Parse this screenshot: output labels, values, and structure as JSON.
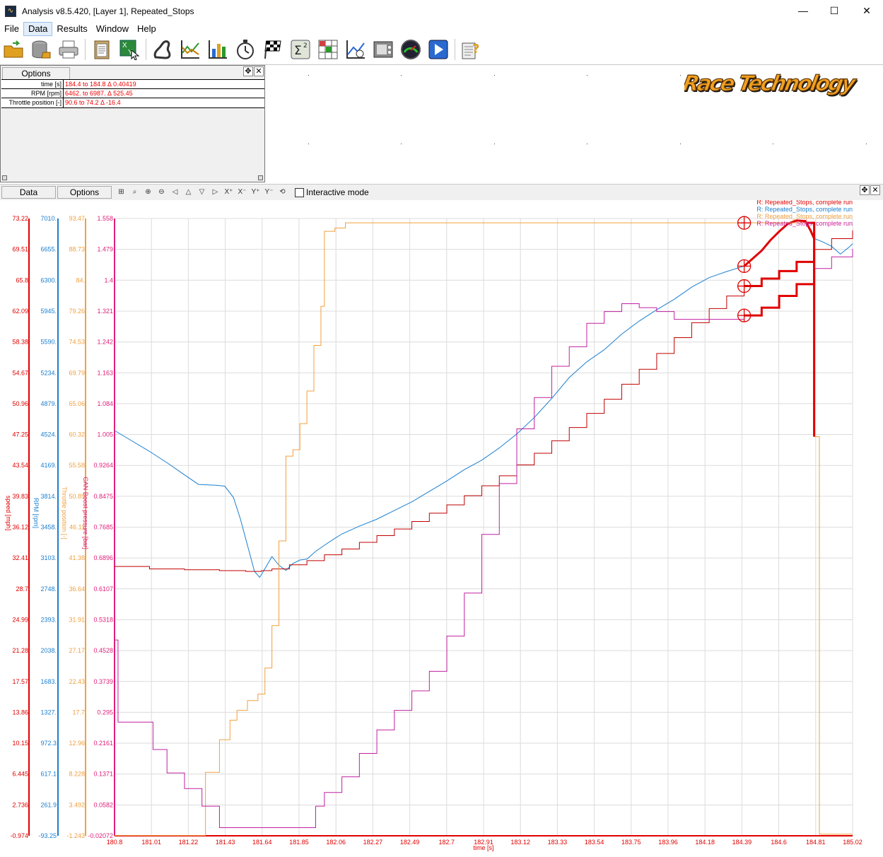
{
  "window": {
    "title": "Analysis v8.5.420, [Layer 1], Repeated_Stops",
    "min_glyph": "—",
    "max_glyph": "☐",
    "close_glyph": "✕"
  },
  "menu": [
    "File",
    "Data",
    "Results",
    "Window",
    "Help"
  ],
  "toolbar_icons": [
    "open-folder-icon",
    "database-icon",
    "printer-icon",
    "clipboard-icon",
    "xy-export-icon",
    "track-map-icon",
    "line-graph-icon",
    "bar-chart-icon",
    "stopwatch-icon",
    "checkered-flag-icon",
    "sigma-squared-icon",
    "lap-table-icon",
    "xy-scatter-icon",
    "video-icon",
    "gauge-icon",
    "play-icon",
    "help-icon"
  ],
  "upper_panel": {
    "options_label": "Options",
    "rows": [
      {
        "name": "time [s]",
        "value": "184.4 to 184.8 Δ 0.40419"
      },
      {
        "name": "RPM [rpm]",
        "value": "6462. to 6987. Δ 525.45"
      },
      {
        "name": "Throttle position [-]",
        "value": "90.6 to 74.2 Δ -16.4"
      }
    ],
    "logo_text": "Race Technology"
  },
  "graph_panel": {
    "tabs": [
      "Data",
      "Options"
    ],
    "interactive_label": "Interactive mode"
  },
  "chart_data": {
    "type": "line",
    "xlabel": "time [s]",
    "x_ticks": [
      "180.8",
      "181.01",
      "181.22",
      "181.43",
      "181.64",
      "181.85",
      "182.06",
      "182.27",
      "182.49",
      "182.7",
      "182.91",
      "183.12",
      "183.33",
      "183.54",
      "183.75",
      "183.96",
      "184.18",
      "184.39",
      "184.6",
      "184.81",
      "185.02"
    ],
    "xlim": [
      180.8,
      185.02
    ],
    "cursor_range": [
      184.4,
      184.8
    ],
    "grid": true,
    "legend": [
      {
        "text": "R:  Repeated_Stops, complete run",
        "color": "#e00000"
      },
      {
        "text": "R:  Repeated_Stops, complete run",
        "color": "#1a7fd0"
      },
      {
        "text": "R:  Repeated_Stops, complete run",
        "color": "#f0a040"
      },
      {
        "text": "R:  Repeated_Stops, complete run",
        "color": "#d0209a"
      }
    ],
    "axes": [
      {
        "label": "speed [mph]",
        "color": "#e00000",
        "ylim": [
          -0.974,
          73.22
        ],
        "ticks": [
          "73.22",
          "69.51",
          "65.8",
          "62.09",
          "58.38",
          "54.67",
          "50.96",
          "47.25",
          "43.54",
          "39.83",
          "36.12",
          "32.41",
          "28.7",
          "24.99",
          "21.28",
          "17.57",
          "13.86",
          "10.15",
          "6.445",
          "2.736",
          "-0.974"
        ]
      },
      {
        "label": "RPM [rpm]",
        "color": "#1a7fd0",
        "ylim": [
          -93.25,
          7010
        ],
        "ticks": [
          "7010.",
          "6655.",
          "6300.",
          "5945.",
          "5590.",
          "5234.",
          "4879.",
          "4524.",
          "4169.",
          "3814.",
          "3458.",
          "3103.",
          "2748.",
          "2393.",
          "2038.",
          "1683.",
          "1327.",
          "972.3",
          "617.1",
          "261.9",
          "-93.25"
        ]
      },
      {
        "label": "Throttle position [-]",
        "color": "#f0a040",
        "ylim": [
          -1.243,
          93.47
        ],
        "ticks": [
          "93.47",
          "88.73",
          "84.",
          "79.26",
          "74.53",
          "69.79",
          "65.06",
          "60.32",
          "55.58",
          "50.85",
          "46.11",
          "41.38",
          "36.64",
          "31.91",
          "27.17",
          "22.43",
          "17.7",
          "12.96",
          "8.228",
          "3.492",
          "-1.243"
        ]
      },
      {
        "label": "CAN Boost pressure [bar]",
        "color": "#e0207a",
        "ylim": [
          -0.02072,
          1.558
        ],
        "ticks": [
          "1.558",
          "1.479",
          "1.4",
          "1.321",
          "1.242",
          "1.163",
          "1.084",
          "1.005",
          "0.9264",
          "0.8475",
          "0.7685",
          "0.6896",
          "0.6107",
          "0.5318",
          "0.4528",
          "0.3739",
          "0.295",
          "0.2161",
          "0.1371",
          "0.0582",
          "-0.02072"
        ]
      }
    ],
    "series": [
      {
        "name": "RPM [rpm]",
        "axis": 1,
        "color": "#1a7fd0",
        "x": [
          180.8,
          180.9,
          181.0,
          181.1,
          181.2,
          181.28,
          181.38,
          181.43,
          181.48,
          181.52,
          181.56,
          181.6,
          181.63,
          181.66,
          181.7,
          181.74,
          181.78,
          181.82,
          181.86,
          181.9,
          181.95,
          182.0,
          182.06,
          182.1,
          182.2,
          182.3,
          182.4,
          182.5,
          182.6,
          182.7,
          182.8,
          182.9,
          183.0,
          183.1,
          183.2,
          183.3,
          183.4,
          183.5,
          183.6,
          183.7,
          183.8,
          183.9,
          184.0,
          184.1,
          184.2,
          184.3,
          184.4,
          184.5,
          184.55,
          184.6,
          184.65,
          184.7,
          184.75,
          184.78,
          184.8,
          184.85,
          184.9,
          184.95,
          185.0,
          185.02
        ],
        "y": [
          4570,
          4450,
          4330,
          4200,
          4060,
          3950,
          3940,
          3930,
          3800,
          3550,
          3250,
          2950,
          2880,
          2980,
          3120,
          3020,
          2960,
          3040,
          3080,
          3090,
          3180,
          3250,
          3330,
          3380,
          3470,
          3550,
          3650,
          3750,
          3870,
          3990,
          4120,
          4230,
          4370,
          4530,
          4720,
          4940,
          5180,
          5360,
          5500,
          5680,
          5830,
          5960,
          6080,
          6220,
          6330,
          6400,
          6462,
          6640,
          6760,
          6860,
          6950,
          6987,
          6980,
          6870,
          6780,
          6740,
          6690,
          6600,
          6680,
          6720
        ]
      },
      {
        "name": "speed [mph]",
        "axis": 0,
        "color": "#c00000",
        "x": [
          180.8,
          181.0,
          181.2,
          181.4,
          181.55,
          181.64,
          181.7,
          181.8,
          181.9,
          182.0,
          182.1,
          182.2,
          182.3,
          182.4,
          182.5,
          182.6,
          182.7,
          182.8,
          182.9,
          183.0,
          183.1,
          183.2,
          183.3,
          183.4,
          183.5,
          183.6,
          183.7,
          183.8,
          183.9,
          184.0,
          184.1,
          184.2,
          184.3,
          184.4,
          184.5,
          184.6,
          184.7,
          184.8,
          184.9,
          185.02
        ],
        "y": [
          31.4,
          31.1,
          31.0,
          30.9,
          30.8,
          30.9,
          31.1,
          31.6,
          32.1,
          32.8,
          33.5,
          34.3,
          35.1,
          35.9,
          36.8,
          37.8,
          38.8,
          39.9,
          41.1,
          42.3,
          43.6,
          45.0,
          46.5,
          48.1,
          49.8,
          51.5,
          53.3,
          55.1,
          57.0,
          58.9,
          60.7,
          62.4,
          63.9,
          65.1,
          66.0,
          66.9,
          68.0,
          69.5,
          70.8,
          71.8
        ]
      },
      {
        "name": "Throttle position [-]",
        "axis": 2,
        "color": "#f0a040",
        "x": [
          180.8,
          181.3,
          181.32,
          181.4,
          181.46,
          181.5,
          181.56,
          181.62,
          181.66,
          181.7,
          181.74,
          181.78,
          181.82,
          181.86,
          181.9,
          181.94,
          181.98,
          182.0,
          182.06,
          182.12,
          184.76,
          184.8,
          184.83,
          185.02
        ],
        "y": [
          -1.2,
          -1.2,
          8.5,
          13.5,
          16.5,
          18.0,
          19.5,
          20.5,
          24.5,
          31.0,
          44.0,
          57.0,
          58.0,
          62.0,
          67.0,
          74.0,
          80.0,
          91.5,
          92.0,
          92.8,
          92.8,
          60.0,
          -1.0,
          -1.0
        ]
      },
      {
        "name": "CAN Boost pressure [bar]",
        "axis": 3,
        "color": "#c020a0",
        "x": [
          180.8,
          180.82,
          180.92,
          181.02,
          181.1,
          181.2,
          181.3,
          181.4,
          181.6,
          181.85,
          181.95,
          182.0,
          182.1,
          182.2,
          182.3,
          182.4,
          182.5,
          182.6,
          182.7,
          182.8,
          182.9,
          183.0,
          183.1,
          183.2,
          183.3,
          183.4,
          183.5,
          183.6,
          183.7,
          183.8,
          183.9,
          184.0,
          184.1,
          184.2,
          184.3,
          184.4,
          184.5,
          184.6,
          184.7,
          184.8,
          184.9,
          185.02
        ],
        "y": [
          0.48,
          0.27,
          0.27,
          0.2,
          0.14,
          0.1,
          0.055,
          0.0,
          0.0,
          0.0,
          0.055,
          0.09,
          0.13,
          0.19,
          0.25,
          0.3,
          0.35,
          0.4,
          0.49,
          0.6,
          0.75,
          0.88,
          1.02,
          1.1,
          1.18,
          1.23,
          1.29,
          1.32,
          1.34,
          1.33,
          1.32,
          1.3,
          1.3,
          1.3,
          1.3,
          1.31,
          1.33,
          1.36,
          1.39,
          1.43,
          1.46,
          1.48
        ]
      }
    ]
  }
}
